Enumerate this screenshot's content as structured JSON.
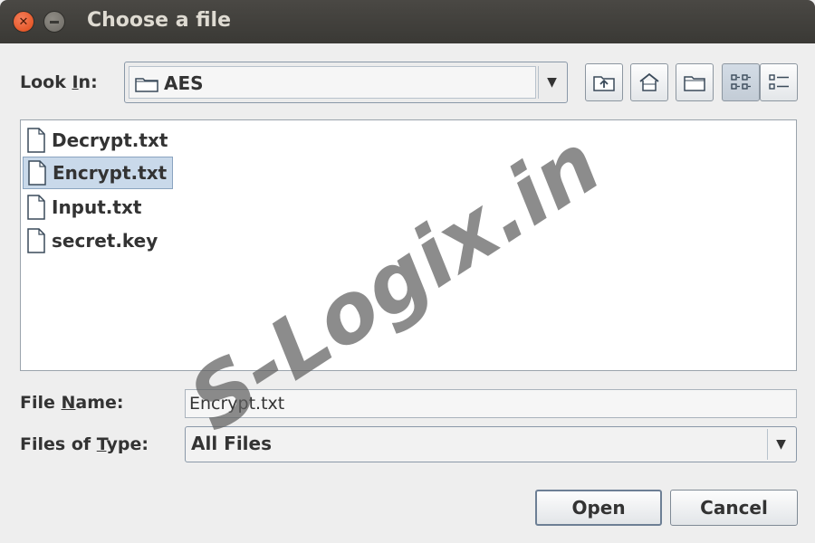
{
  "window": {
    "title": "Choose a file",
    "close_glyph": "✕"
  },
  "lookin": {
    "label_pre": "Look ",
    "label_mnemonic": "I",
    "label_post": "n:",
    "value": "AES"
  },
  "toolbar": {
    "buttons": [
      {
        "name": "up-one-level-icon"
      },
      {
        "name": "home-icon"
      },
      {
        "name": "new-folder-icon"
      },
      {
        "name": "list-view-icon",
        "active": true
      },
      {
        "name": "details-view-icon"
      }
    ]
  },
  "files": [
    {
      "name": "Decrypt.txt"
    },
    {
      "name": "Encrypt.txt",
      "selected": true
    },
    {
      "name": "Input.txt"
    },
    {
      "name": "secret.key"
    }
  ],
  "filename": {
    "label_pre": "File ",
    "label_mnemonic": "N",
    "label_post": "ame:",
    "value": "Encrypt.txt"
  },
  "filetype": {
    "label_pre": "Files of ",
    "label_mnemonic": "T",
    "label_post": "ype:",
    "value": "All Files"
  },
  "buttons": {
    "open": "Open",
    "cancel": "Cancel"
  },
  "watermark": "S-Logix.in",
  "colors": {
    "titlebar": "#3c3b37",
    "close_button": "#df4a16",
    "selection": "#c9d9ea",
    "background": "#eeeeee"
  }
}
